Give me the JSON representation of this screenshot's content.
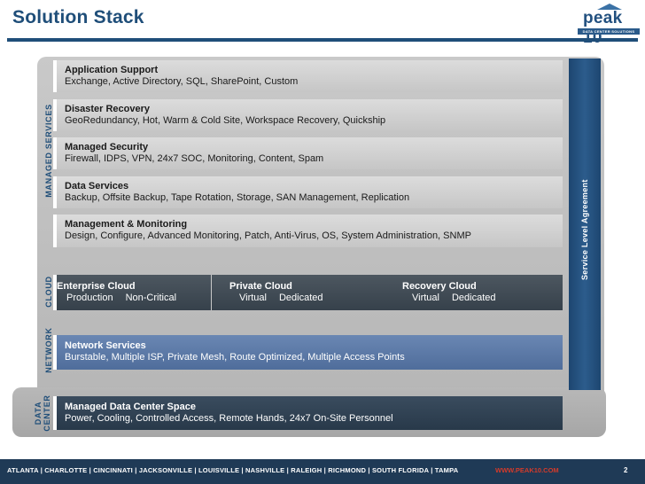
{
  "header": {
    "title": "Solution Stack"
  },
  "logo": {
    "name": "peak 10",
    "tagline": "DATA CENTER SOLUTIONS"
  },
  "side_labels": {
    "managed_services": "MANAGED SERVICES",
    "cloud": "CLOUD",
    "network": "NETWORK",
    "data_center": "DATA CENTER"
  },
  "sla": {
    "label": "Service Level Agreement"
  },
  "managed": [
    {
      "title": "Application Support",
      "desc": "Exchange, Active Directory, SQL, SharePoint, Custom"
    },
    {
      "title": "Disaster Recovery",
      "desc": "GeoRedundancy, Hot, Warm & Cold Site, Workspace Recovery, Quickship"
    },
    {
      "title": "Managed Security",
      "desc": "Firewall, IDPS, VPN, 24x7 SOC, Monitoring, Content, Spam"
    },
    {
      "title": "Data Services",
      "desc": "Backup, Offsite Backup, Tape Rotation, Storage, SAN Management, Replication"
    },
    {
      "title": "Management & Monitoring",
      "desc": "Design, Configure, Advanced Monitoring, Patch, Anti-Virus, OS, System Administration, SNMP"
    }
  ],
  "cloud": [
    {
      "title": "Enterprise Cloud",
      "opt1": "Production",
      "opt2": "Non-Critical"
    },
    {
      "title": "Private Cloud",
      "opt1": "Virtual",
      "opt2": "Dedicated"
    },
    {
      "title": "Recovery Cloud",
      "opt1": "Virtual",
      "opt2": "Dedicated"
    }
  ],
  "network": {
    "title": "Network Services",
    "desc": "Burstable, Multiple ISP, Private Mesh, Route Optimized, Multiple Access Points"
  },
  "data_center": {
    "title": "Managed Data Center Space",
    "desc": "Power, Cooling, Controlled Access, Remote Hands, 24x7 On-Site Personnel"
  },
  "footer": {
    "cities": "ATLANTA  |  CHARLOTTE  |  CINCINNATI  |  JACKSONVILLE  |  LOUISVILLE  |  NASHVILLE  |  RALEIGH  |  RICHMOND  |  SOUTH FLORIDA  |  TAMPA",
    "url": "WWW.PEAK10.COM",
    "page": "2"
  },
  "colors": {
    "brand": "#1f4e79",
    "footer_bg": "#1f3a56",
    "url": "#d43a2a",
    "cloud_box": "#3f4a55",
    "network_box": "#5b79a7",
    "datacenter_box": "#2f4254"
  }
}
